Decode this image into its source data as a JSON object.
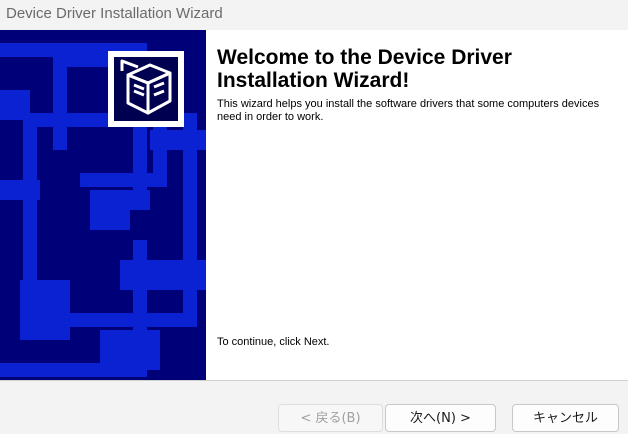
{
  "window": {
    "title": "Device Driver Installation Wizard"
  },
  "main": {
    "heading": "Welcome to the Device Driver Installation Wizard!",
    "description": "This wizard helps you install the software drivers that some computers devices need in order to work.",
    "continue_text": "To continue, click Next."
  },
  "buttons": {
    "back_label": "< 戻る(B)",
    "next_label": "次へ(N) >",
    "cancel_label": "キャンセル"
  },
  "icons": {
    "wizard_logo": "hardware-box-icon"
  },
  "colors": {
    "panel": "#000078",
    "panel_shapes": "#0a22d2",
    "background": "#ffffff"
  }
}
